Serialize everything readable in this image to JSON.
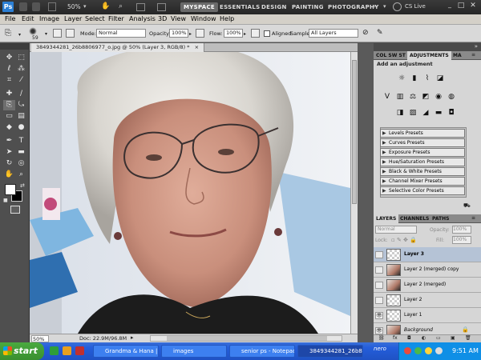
{
  "titlebar": {
    "app_logo": "Ps",
    "zoom": "50%",
    "workspaces": [
      "MYSPACE",
      "ESSENTIALS",
      "DESIGN",
      "PAINTING",
      "PHOTOGRAPHY"
    ],
    "cs_live": "CS Live",
    "window_buttons": [
      "_",
      "□",
      "✕"
    ]
  },
  "menu": [
    "File",
    "Edit",
    "Image",
    "Layer",
    "Select",
    "Filter",
    "Analysis",
    "3D",
    "View",
    "Window",
    "Help"
  ],
  "options": {
    "brush_size": "59",
    "mode_label": "Mode:",
    "mode_value": "Normal",
    "opacity_label": "Opacity:",
    "opacity_value": "100%",
    "flow_label": "Flow:",
    "flow_value": "100%",
    "aligned_label": "Aligned",
    "sample_label": "Sample:",
    "sample_value": "All Layers"
  },
  "document": {
    "tab_title": "3849344281_26b8806977_o.jpg @ 50% (Layer 3, RGB/8) *",
    "zoom": "50%",
    "doc_info": "Doc: 22.9M/96.8M"
  },
  "adjustments": {
    "tabs": [
      "COL SW ST",
      "ADJUSTMENTS",
      "MA"
    ],
    "heading": "Add an adjustment",
    "presets": [
      "Levels Presets",
      "Curves Presets",
      "Exposure Presets",
      "Hue/Saturation Presets",
      "Black & White Presets",
      "Channel Mixer Presets",
      "Selective Color Presets"
    ]
  },
  "layers": {
    "tabs": [
      "LAYERS",
      "CHANNELS",
      "PATHS"
    ],
    "blend_mode": "Normal",
    "opacity_label": "Opacity:",
    "opacity_value": "100%",
    "lock_label": "Lock:",
    "fill_label": "Fill:",
    "fill_value": "100%",
    "items": [
      {
        "name": "Layer 3",
        "selected": true
      },
      {
        "name": "Layer 2 (merged) copy",
        "selected": false
      },
      {
        "name": "Layer 2 (merged)",
        "selected": false
      },
      {
        "name": "Layer 2",
        "selected": false
      },
      {
        "name": "Layer 1",
        "selected": false
      },
      {
        "name": "Background",
        "selected": false
      }
    ]
  },
  "taskbar": {
    "start": "start",
    "items": [
      "Grandma & Hana | ...",
      "images",
      "senior ps - Notepad",
      "3849344281_26b8..."
    ],
    "tray_brand": "nero",
    "clock": "9:51 AM"
  },
  "colors": {
    "accent": "#245edb",
    "start_green": "#3a8f30",
    "ps_blue": "#2b7fd4"
  }
}
